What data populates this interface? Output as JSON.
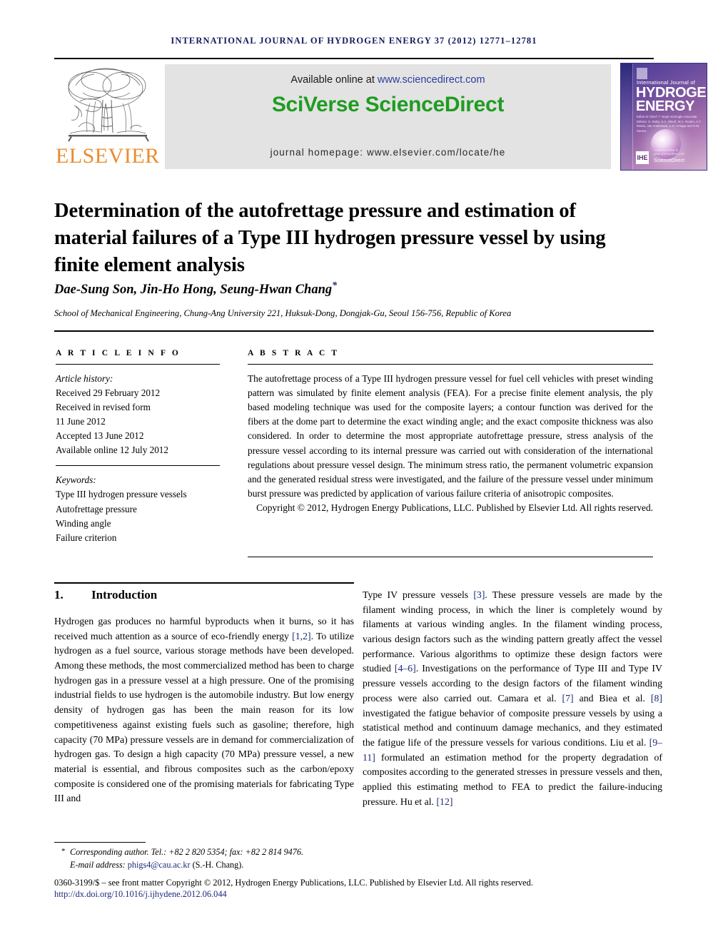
{
  "running_head": "International Journal of Hydrogen Energy 37 (2012) 12771–12781",
  "masthead": {
    "publisher_name": "ELSEVIER",
    "available_prefix": "Available online at ",
    "available_url": "www.sciencedirect.com",
    "platform_title": "SciVerse ScienceDirect",
    "homepage_line": "journal homepage: www.elsevier.com/locate/he",
    "cover": {
      "line_sub": "International Journal of",
      "line_1": "HYDROGEN",
      "line_2": "ENERGY",
      "editors": "Editor-in-Chief: T. Nejat Veziroglu    Associate Editors: S. Dutta, S.A. Sherif, M.A. Rosen, A.T. Raissi, Jan Andersson, L.G. Arriaga and D.M. Santos",
      "hpe_mark": "IHE",
      "sciencedirect_mark": "ScienceDirect",
      "sciencedirect_above": "Available online at www.sciencedirect.com"
    },
    "accent_green": "#1f9c20",
    "accent_orange": "#eb8b2d",
    "link_blue": "#2b3f9e",
    "banner_bg": "#e3e3e3"
  },
  "article": {
    "title": "Determination of the autofrettage pressure and estimation of material failures of a Type III hydrogen pressure vessel by using finite element analysis",
    "authors": "Dae-Sung Son, Jin-Ho Hong, Seung-Hwan Chang",
    "author_star": "*",
    "affiliation": "School of Mechanical Engineering, Chung-Ang University 221, Huksuk-Dong, Dongjak-Gu, Seoul 156-756, Republic of Korea"
  },
  "article_info": {
    "label": "A R T I C L E   I N F O",
    "history_label": "Article history:",
    "history": [
      "Received 29 February 2012",
      "Received in revised form",
      "11 June 2012",
      "Accepted 13 June 2012",
      "Available online 12 July 2012"
    ],
    "keywords_label": "Keywords:",
    "keywords": [
      "Type III hydrogen pressure vessels",
      "Autofrettage pressure",
      "Winding angle",
      "Failure criterion"
    ]
  },
  "abstract": {
    "label": "A B S T R A C T",
    "text": "The autofrettage process of a Type III hydrogen pressure vessel for fuel cell vehicles with preset winding pattern was simulated by finite element analysis (FEA). For a precise finite element analysis, the ply based modeling technique was used for the composite layers; a contour function was derived for the fibers at the dome part to determine the exact winding angle; and the exact composite thickness was also considered. In order to determine the most appropriate autofrettage pressure, stress analysis of the pressure vessel according to its internal pressure was carried out with consideration of the international regulations about pressure vessel design. The minimum stress ratio, the permanent volumetric expansion and the generated residual stress were investigated, and the failure of the pressure vessel under minimum burst pressure was predicted by application of various failure criteria of anisotropic composites.",
    "copyright": "Copyright © 2012, Hydrogen Energy Publications, LLC. Published by Elsevier Ltd. All rights reserved."
  },
  "body": {
    "section_number": "1.",
    "section_title": "Introduction",
    "left_paragraph_pre": "Hydrogen gas produces no harmful byproducts when it burns, so it has received much attention as a source of eco-friendly energy ",
    "ref_12": "[1,2]",
    "left_paragraph_post": ". To utilize hydrogen as a fuel source, various storage methods have been developed. Among these methods, the most commercialized method has been to charge hydrogen gas in a pressure vessel at a high pressure. One of the promising industrial fields to use hydrogen is the automobile industry. But low energy density of hydrogen gas has been the main reason for its low competitiveness against existing fuels such as gasoline; therefore, high capacity (70 MPa) pressure vessels are in demand for commercialization of hydrogen gas. To design a high capacity (70 MPa) pressure vessel, a new material is essential, and fibrous composites such as the carbon/epoxy composite is considered one of the promising materials for fabricating Type III and",
    "right_p1": "Type IV pressure vessels ",
    "ref_3": "[3]",
    "right_p2": ". These pressure vessels are made by the filament winding process, in which the liner is completely wound by filaments at various winding angles. In the filament winding process, various design factors such as the winding pattern greatly affect the vessel performance. Various algorithms to optimize these design factors were studied ",
    "ref_46": "[4–6]",
    "right_p3": ". Investigations on the performance of Type III and Type IV pressure vessels according to the design factors of the filament winding process were also carried out. Camara et al. ",
    "ref_7": "[7]",
    "right_p4": " and Biea et al. ",
    "ref_8": "[8]",
    "right_p5": " investigated the fatigue behavior of composite pressure vessels by using a statistical method and continuum damage mechanics, and they estimated the fatigue life of the pressure vessels for various conditions. Liu et al. ",
    "ref_911": "[9–11]",
    "right_p6": " formulated an estimation method for the property degradation of composites according to the generated stresses in pressure vessels and then, applied this estimating method to FEA to predict the failure-inducing pressure. Hu et al. ",
    "ref_12b": "[12]"
  },
  "footer": {
    "star": "*",
    "corresponding": "Corresponding author. Tel.: +82 2 820 5354; fax: +82 2 814 9476.",
    "email_label": "E-mail address: ",
    "email": "phigs4@cau.ac.kr",
    "email_suffix": " (S.-H. Chang).",
    "issn": "0360-3199/$ – see front matter Copyright © 2012, Hydrogen Energy Publications, LLC. Published by Elsevier Ltd. All rights reserved.",
    "doi": "http://dx.doi.org/10.1016/j.ijhydene.2012.06.044"
  }
}
